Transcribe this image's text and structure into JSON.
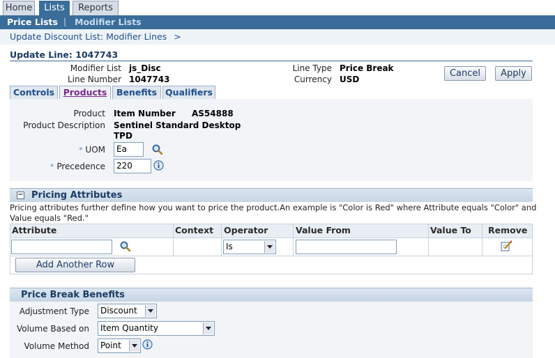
{
  "top_tabs": [
    {
      "label": "Home",
      "active": false
    },
    {
      "label": "Lists",
      "active": true
    },
    {
      "label": "Reports",
      "active": false
    }
  ],
  "subnav": {
    "price_lists": "Price Lists",
    "separator": "|",
    "modifier_lists": "Modifier Lists"
  },
  "breadcrumb": {
    "link": "Update Discount List: Modifier Lines",
    "arrow": ">"
  },
  "page_title": "Update Line: 1047743",
  "header": {
    "modifier_list_label": "Modifier List",
    "modifier_list_value": "js_Disc",
    "line_number_label": "Line Number",
    "line_number_value": "1047743",
    "line_type_label": "Line Type",
    "line_type_value": "Price Break",
    "currency_label": "Currency",
    "currency_value": "USD"
  },
  "buttons": {
    "cancel": "Cancel",
    "apply": "Apply"
  },
  "sub_tabs": [
    {
      "label": "Controls",
      "active": false
    },
    {
      "label": "Products",
      "active": true
    },
    {
      "label": "Benefits",
      "active": false
    },
    {
      "label": "Qualifiers",
      "active": false
    }
  ],
  "product": {
    "product_label": "Product",
    "product_type": "Item Number",
    "product_value": "AS54888",
    "description_label": "Product Description",
    "description_line1": "Sentinel Standard Desktop",
    "description_line2": "TPD",
    "required_marker": "*",
    "uom_label": "UOM",
    "uom_value": "Ea",
    "precedence_label": "Precedence",
    "precedence_value": "220"
  },
  "pricing_attributes": {
    "toggle": "−",
    "title": "Pricing Attributes",
    "description_line1": "Pricing attributes further define how you want to price the product.An example is \"Color is Red\" where Attribute equals \"Color\" and",
    "description_line2": "Value equals \"Red.\"",
    "columns": [
      "Attribute",
      "Context",
      "Operator",
      "Value From",
      "Value To",
      "Remove"
    ],
    "rows": [
      {
        "attribute": "",
        "context": "",
        "operator": "Is",
        "value_from": "",
        "value_to": ""
      }
    ],
    "add_row_button": "Add Another Row"
  },
  "price_break_benefits": {
    "title": "Price Break Benefits",
    "adjustment_type_label": "Adjustment Type",
    "adjustment_type_value": "Discount",
    "volume_based_on_label": "Volume Based on",
    "volume_based_on_value": "Item Quantity",
    "volume_method_label": "Volume Method",
    "volume_method_value": "Point"
  },
  "icons": {
    "search": "magnifier-icon",
    "info": "info-icon",
    "remove": "edit-remove-icon"
  },
  "colors": {
    "brand_blue": "#3a6d9a",
    "link": "#1f4e8c",
    "section_header": "#c7d5e4"
  }
}
